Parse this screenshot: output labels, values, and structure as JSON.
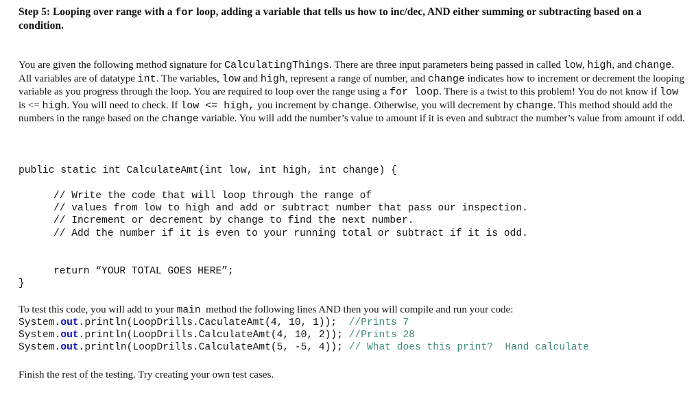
{
  "heading": {
    "part1": "Step 5:  Looping over range with a ",
    "code": "for",
    "part2": "  loop,  adding a variable that tells us how to inc/dec, AND either summing or subtracting based on a condition."
  },
  "paragraph": {
    "s1": "You are given the following method signature for ",
    "c1": "CalculatingThings",
    "s2": ".  There are three input parameters being passed in called ",
    "c2": "low",
    "s3": ", ",
    "c3": "high",
    "s4": ", and ",
    "c4": "change",
    "s5": ".   All variables are of datatype ",
    "c5": "int",
    "s6": ".  The variables, ",
    "c6": "low",
    "s7": " and ",
    "c7": "high",
    "s8": ", represent a range of number, and ",
    "c8": "change",
    "s9": " indicates how to increment or decrement the looping variable as you progress through the loop.   You are required to loop over the range using a ",
    "c9": "for loop",
    "s10": ".  There is a twist to this problem!  You do not know if ",
    "c10": "low",
    "s11": " is <= ",
    "c11": "high",
    "s12": ".  You will need to check.  If ",
    "c12": "low  <= high,",
    "s13": " you increment by ",
    "c13": "change",
    "s14": ".  Otherwise, you will decrement by ",
    "c14": "change",
    "s15": ".  This method should add the numbers in the range based on the ",
    "c15": "change",
    "s16": " variable.  You will add the number’s value to amount if it is even and subtract the number’s value from amount if odd."
  },
  "code": {
    "signature": "public static int CalculateAmt(int low, int high, int change) {",
    "comments": [
      "// Write the code that will loop through the range of",
      "// values from low to high and add or subtract number that pass our inspection.",
      "// Increment or decrement by change to find the next number.",
      "// Add the number if it is even to your running total or subtract if it is odd."
    ],
    "return_line": "return “YOUR TOTAL GOES HERE”;",
    "closing_brace": "}"
  },
  "testing": {
    "intro_a": "To test this code, you will add to your ",
    "intro_code": "main",
    "intro_b": "  method the following lines AND then you will compile and run your code:",
    "lines": [
      {
        "pre": "System.",
        "kw": "out",
        "post": ".println(LoopDrills.CaculateAmt(4, 10, 1));  ",
        "comment": "//Prints 7"
      },
      {
        "pre": "System.",
        "kw": "out",
        "post": ".println(LoopDrills.CalculateAmt(4, 10, 2)); ",
        "comment": "//Prints 28"
      },
      {
        "pre": "System.",
        "kw": "out",
        "post": ".println(LoopDrills.CalculateAmt(5, -5, 4)); ",
        "comment": "// What does this print?  Hand calculate"
      }
    ],
    "finish": "Finish the rest of the testing.  Try creating your own test cases."
  }
}
